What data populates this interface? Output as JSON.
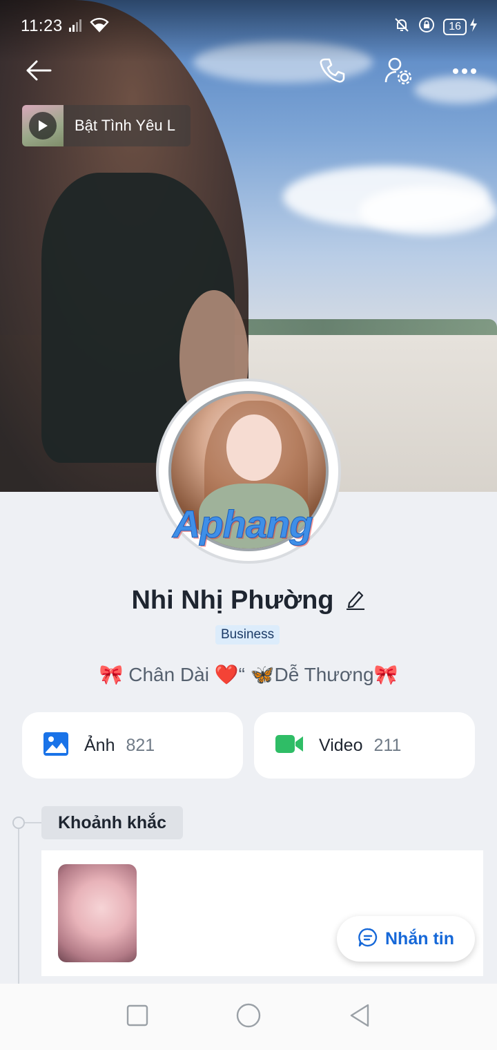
{
  "status_bar": {
    "time": "11:23",
    "battery": "16"
  },
  "header": {
    "back_icon": "arrow-left-icon",
    "call_icon": "phone-icon",
    "settings_icon": "user-settings-icon",
    "more_icon": "more-horizontal-icon"
  },
  "music": {
    "title": "Bật Tình Yêu L"
  },
  "profile": {
    "name": "Nhi Nhị Phường",
    "badge": "Business",
    "bio": "🎀 Chân Dài ❤️“ 🦋Dễ Thương🎀",
    "watermark": "Aphang"
  },
  "media": [
    {
      "label": "Ảnh",
      "count": "821",
      "icon": "image-icon",
      "color": "#1a73e8"
    },
    {
      "label": "Video",
      "count": "211",
      "icon": "video-camera-icon",
      "color": "#2fbd66"
    }
  ],
  "moments": {
    "label": "Khoảnh khắc"
  },
  "message_button": {
    "label": "Nhắn tin"
  },
  "accent_colors": {
    "primary": "#1668d8",
    "badge_bg": "#dcecfb"
  }
}
